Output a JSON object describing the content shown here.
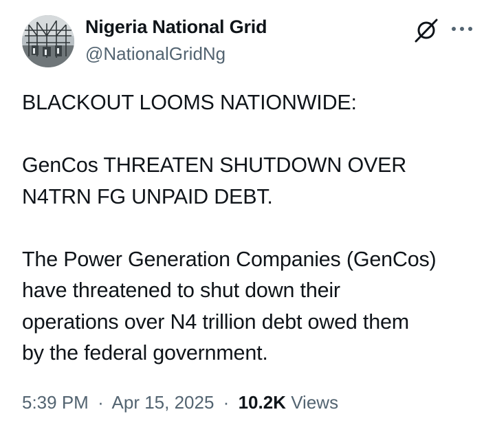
{
  "author": {
    "display_name": "Nigeria National Grid",
    "handle": "@NationalGridNg",
    "avatar_icon": "power-substation-avatar"
  },
  "header_actions": {
    "grok_icon": "grok-icon",
    "more_icon": "more-options-icon"
  },
  "tweet": {
    "paragraphs": [
      [
        "BLACKOUT LOOMS NATIONWIDE:"
      ],
      [
        "GenCos THREATEN SHUTDOWN OVER",
        "N4TRN FG UNPAID DEBT."
      ],
      [
        "The Power Generation Companies (GenCos)",
        "have threatened to shut down their",
        "operations over N4 trillion debt owed them",
        "by the federal government."
      ]
    ]
  },
  "meta": {
    "time": "5:39 PM",
    "separator": "·",
    "date": "Apr 15, 2025",
    "views_count": "10.2K",
    "views_label": "Views"
  },
  "colors": {
    "text_primary": "#0f1419",
    "text_secondary": "#536471",
    "background": "#ffffff"
  }
}
